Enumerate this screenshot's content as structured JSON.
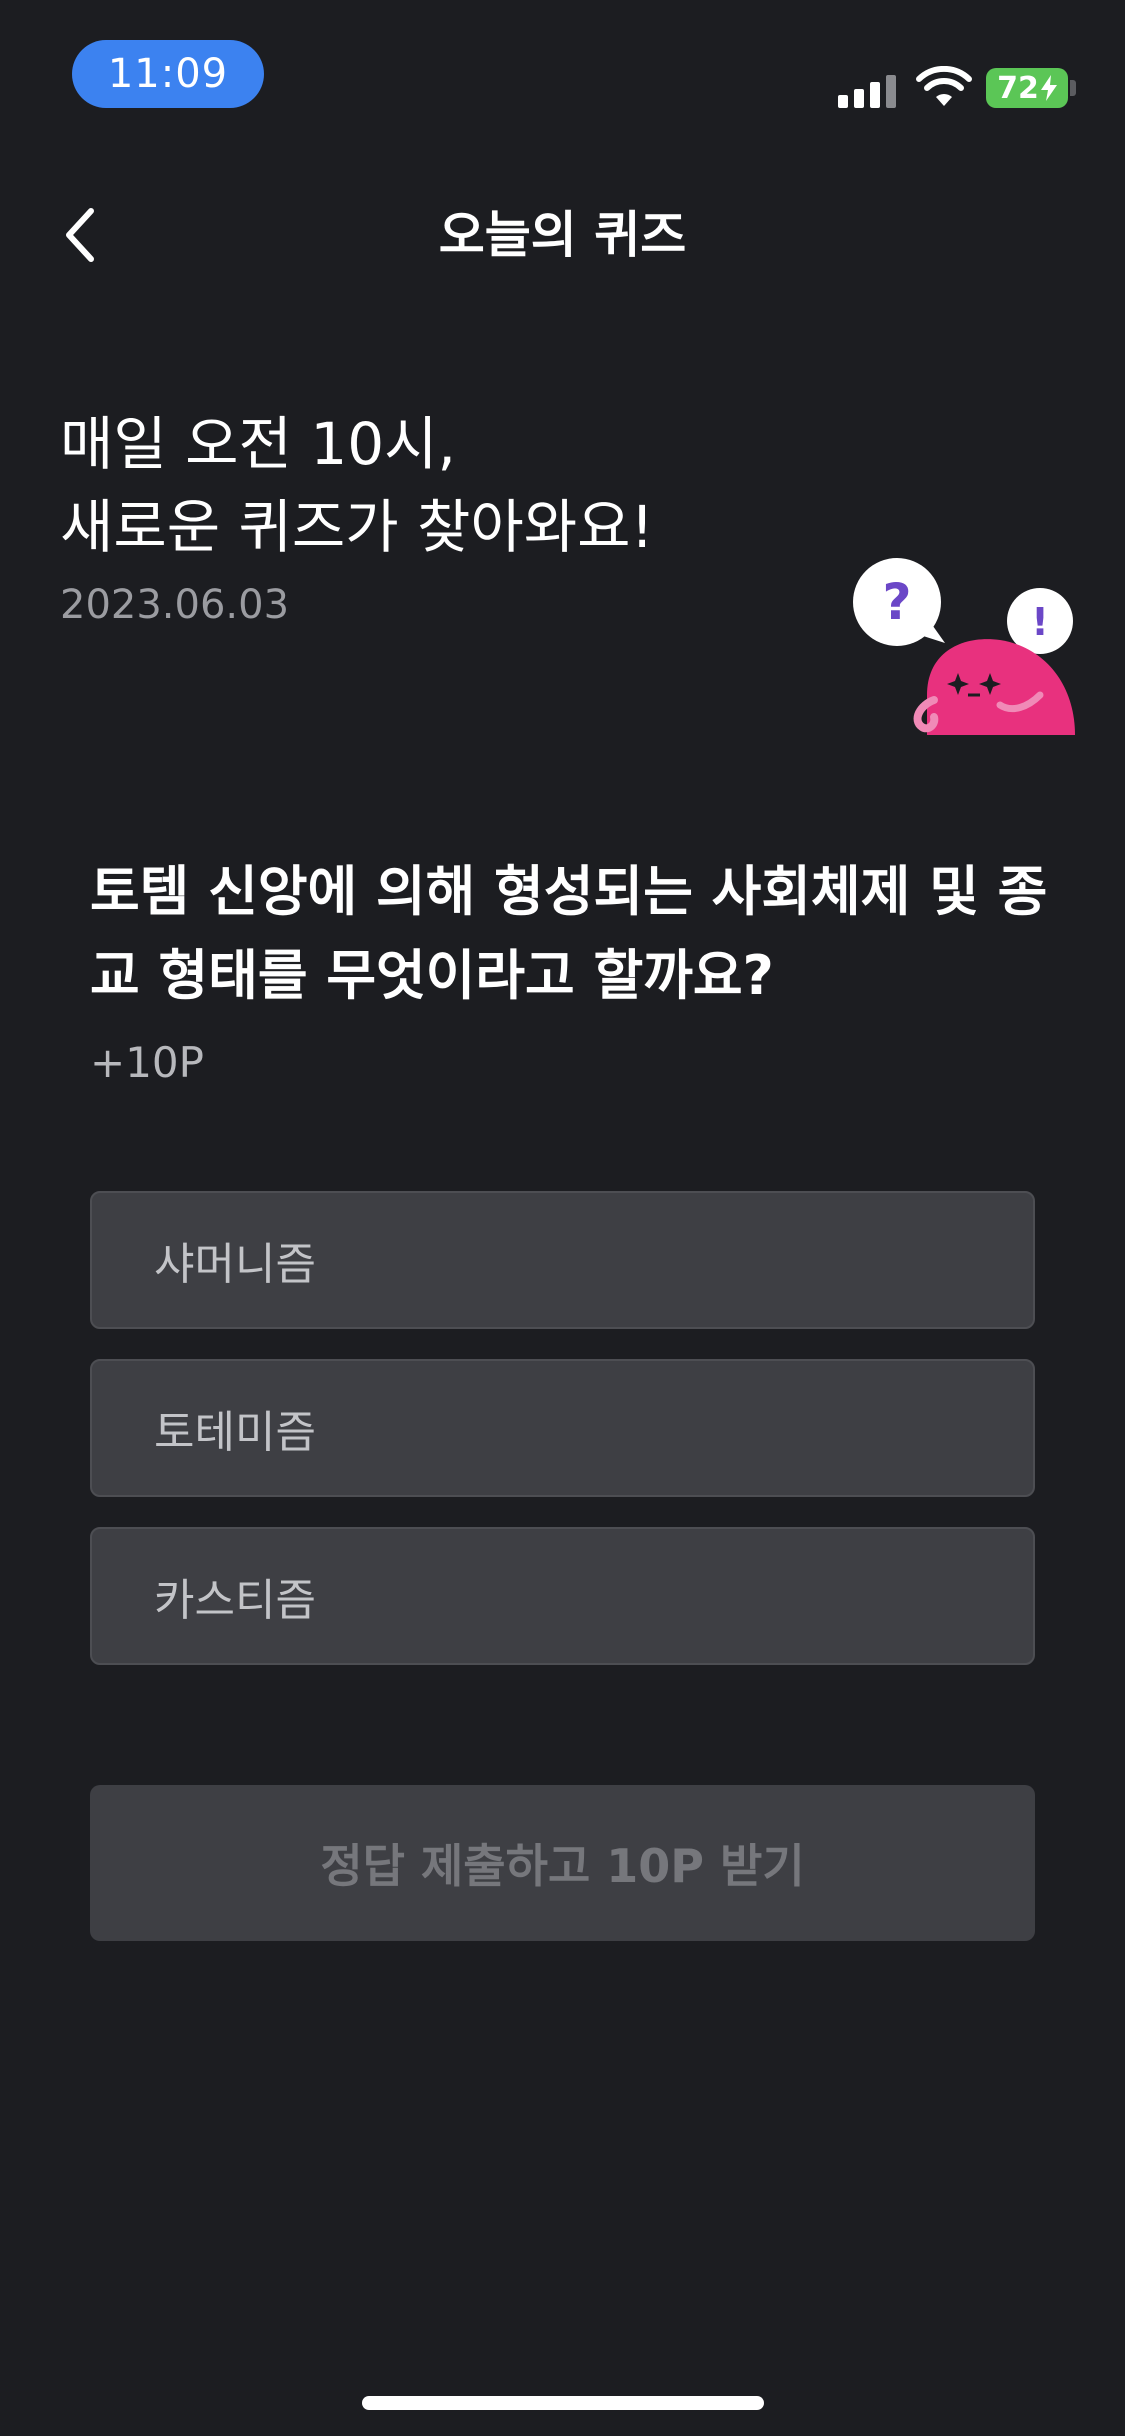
{
  "status_bar": {
    "time": "11:09",
    "battery": "72",
    "signal_icon": "cellular-signal-icon",
    "wifi_icon": "wifi-icon",
    "battery_icon": "battery-charging-icon"
  },
  "header": {
    "back_icon": "chevron-left-icon",
    "title": "오늘의 퀴즈"
  },
  "intro": {
    "line1": "매일 오전 10시,",
    "line2": "새로운 퀴즈가 찾아와요!",
    "date": "2023.06.03",
    "mascot_icon": "quiz-mascot-icon",
    "mascot_bubble_question": "?",
    "mascot_bubble_exclaim": "!"
  },
  "quiz": {
    "question": "토템 신앙에 의해 형성되는 사회체제 및 종교 형태를 무엇이라고 할까요?",
    "points": "+10P",
    "options": [
      {
        "label": "샤머니즘"
      },
      {
        "label": "토테미즘"
      },
      {
        "label": "카스티즘"
      }
    ],
    "submit_label": "정답 제출하고 10P 받기"
  },
  "colors": {
    "background": "#1c1d21",
    "time_pill": "#3c82f0",
    "battery": "#5bc656",
    "option_bg": "#3e3f44",
    "mascot": "#e8317e",
    "mascot_accent": "#6b47c7"
  }
}
